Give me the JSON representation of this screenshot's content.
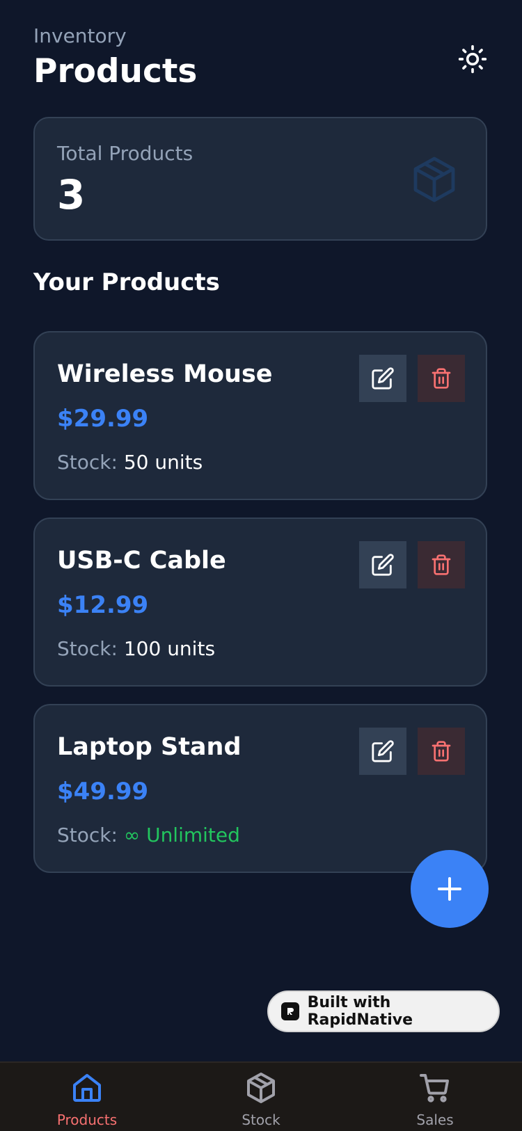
{
  "header": {
    "eyebrow": "Inventory",
    "title": "Products",
    "theme_icon": "sun-icon"
  },
  "summary": {
    "label": "Total Products",
    "value": "3",
    "icon": "package-icon"
  },
  "section_title": "Your Products",
  "products": [
    {
      "name": "Wireless Mouse",
      "price": "$29.99",
      "stock_label": "Stock:",
      "stock_value": "50 units",
      "unlimited": false
    },
    {
      "name": "USB-C Cable",
      "price": "$12.99",
      "stock_label": "Stock:",
      "stock_value": "100 units",
      "unlimited": false
    },
    {
      "name": "Laptop Stand",
      "price": "$49.99",
      "stock_label": "Stock:",
      "stock_value": "∞ Unlimited",
      "unlimited": true
    }
  ],
  "fab": {
    "icon": "plus-icon"
  },
  "badge": {
    "text": "Built with RapidNative"
  },
  "tabs": [
    {
      "label": "Products",
      "icon": "home-icon",
      "active": true
    },
    {
      "label": "Stock",
      "icon": "package-icon",
      "active": false
    },
    {
      "label": "Sales",
      "icon": "cart-icon",
      "active": false
    }
  ],
  "colors": {
    "background": "#0f172a",
    "card": "#1e293b",
    "accent": "#3b82f6",
    "danger": "#f87171",
    "success": "#22c55e"
  }
}
